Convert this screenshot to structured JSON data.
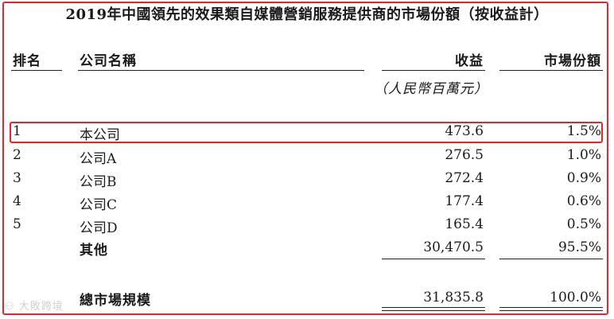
{
  "title": "2019年中國領先的效果類自媒體營銷服務提供商的市場份額（按收益計）",
  "columns": {
    "rank": "排名",
    "company": "公司名稱",
    "revenue": "收益",
    "share": "市場份額"
  },
  "unit": "（人民幣百萬元）",
  "rows": [
    {
      "rank": "1",
      "company": "本公司",
      "revenue": "473.6",
      "share": "1.5%"
    },
    {
      "rank": "2",
      "company": "公司A",
      "revenue": "276.5",
      "share": "1.0%"
    },
    {
      "rank": "3",
      "company": "公司B",
      "revenue": "272.4",
      "share": "0.9%"
    },
    {
      "rank": "4",
      "company": "公司C",
      "revenue": "177.4",
      "share": "0.6%"
    },
    {
      "rank": "5",
      "company": "公司D",
      "revenue": "165.4",
      "share": "0.5%"
    }
  ],
  "others": {
    "company": "其他",
    "revenue": "30,470.5",
    "share": "95.5%"
  },
  "total": {
    "company": "總市場規模",
    "revenue": "31,835.8",
    "share": "100.0%"
  },
  "watermark": "大敗跨境",
  "highlight_color": "#e0282b"
}
